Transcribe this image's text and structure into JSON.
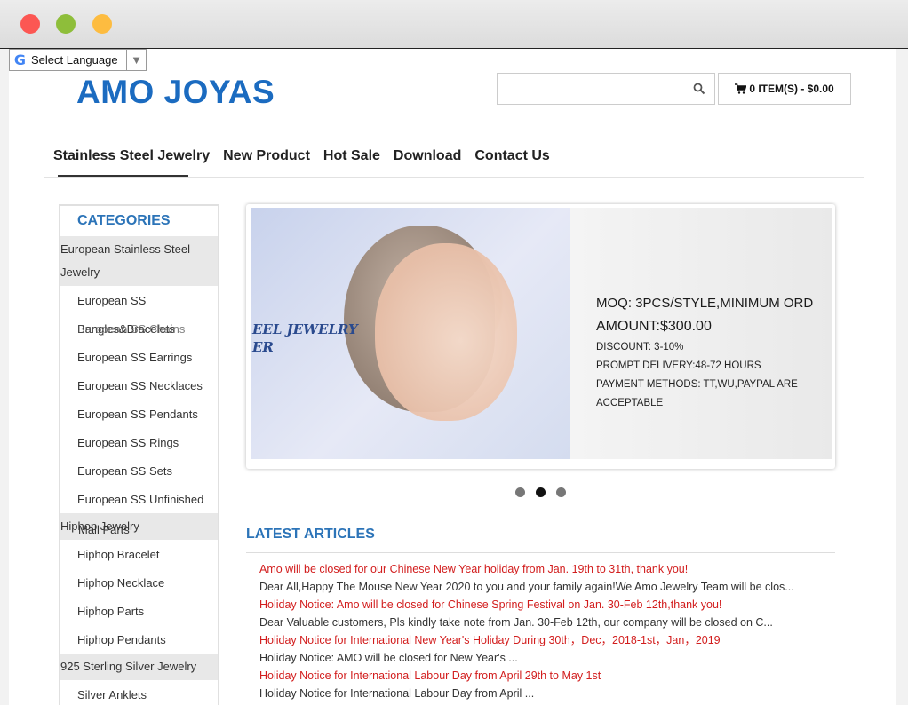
{
  "window": {
    "controls": [
      "close",
      "minimize",
      "maximize"
    ]
  },
  "translate": {
    "label": "Select Language",
    "logo": "G"
  },
  "site": {
    "logo_text": "AMO JOYAS",
    "brand_color": "#1b6bc0"
  },
  "search": {
    "value": "",
    "placeholder": ""
  },
  "cart": {
    "label": "0 ITEM(S) - $0.00"
  },
  "nav": [
    "Stainless Steel Jewelry",
    "New Product",
    "Hot Sale",
    "Download",
    "Contact Us"
  ],
  "sidebar": {
    "title": "CATEGORIES",
    "groups": [
      {
        "label": "European Stainless Steel Jewelry",
        "items": [
          "European SS",
          "Bangles&Bracelets",
          "European SS Earrings",
          "European SS Necklaces",
          "European SS Pendants",
          "European SS Rings",
          "European SS Sets",
          "European SS Unfinished"
        ]
      },
      {
        "label": "Hiphop Jewelry",
        "items": [
          "Hiphop Bracelet",
          "Hiphop Necklace",
          "Hiphop Parts",
          "Hiphop Pendants"
        ]
      },
      {
        "label": "925 Sterling Silver Jewelry",
        "items": [
          "Silver Anklets"
        ]
      }
    ],
    "overlap_texts": [
      "European SS Chains",
      "Mall Parts"
    ]
  },
  "banner": {
    "left_text_1": "EEL JEWELRY",
    "left_text_2": "ER",
    "moq_line": "MOQ: 3PCS/STYLE,MINIMUM ORD",
    "amount_line": "AMOUNT:$300.00",
    "discount": "DISCOUNT: 3-10%",
    "delivery": "PROMPT DELIVERY:48-72 HOURS",
    "payment": "PAYMENT METHODS: TT,WU,PAYPAL ARE ACCEPTABLE"
  },
  "slider": {
    "slide_count": 3,
    "active_index": 1
  },
  "latest": {
    "title": "LATEST ARTICLES",
    "articles": [
      {
        "title": "Amo will be closed for our Chinese New Year holiday from Jan. 19th to 31th, thank you!",
        "desc": "Dear All,Happy The Mouse New Year 2020 to you and your family again!We Amo Jewelry Team will be clos..."
      },
      {
        "title": "Holiday Notice: Amo will be closed for Chinese Spring Festival on Jan. 30-Feb 12th,thank you!",
        "desc": "Dear Valuable customers, Pls kindly take note from Jan. 30-Feb 12th, our company will be closed on C..."
      },
      {
        "title": "Holiday Notice for International New Year's Holiday During 30th，Dec，2018-1st，Jan，2019",
        "desc": " Holiday Notice: AMO will be closed for New Year's ..."
      },
      {
        "title": "Holiday Notice for International Labour Day from April 29th to May 1st",
        "desc": " Holiday Notice for International Labour Day from April ..."
      }
    ]
  }
}
